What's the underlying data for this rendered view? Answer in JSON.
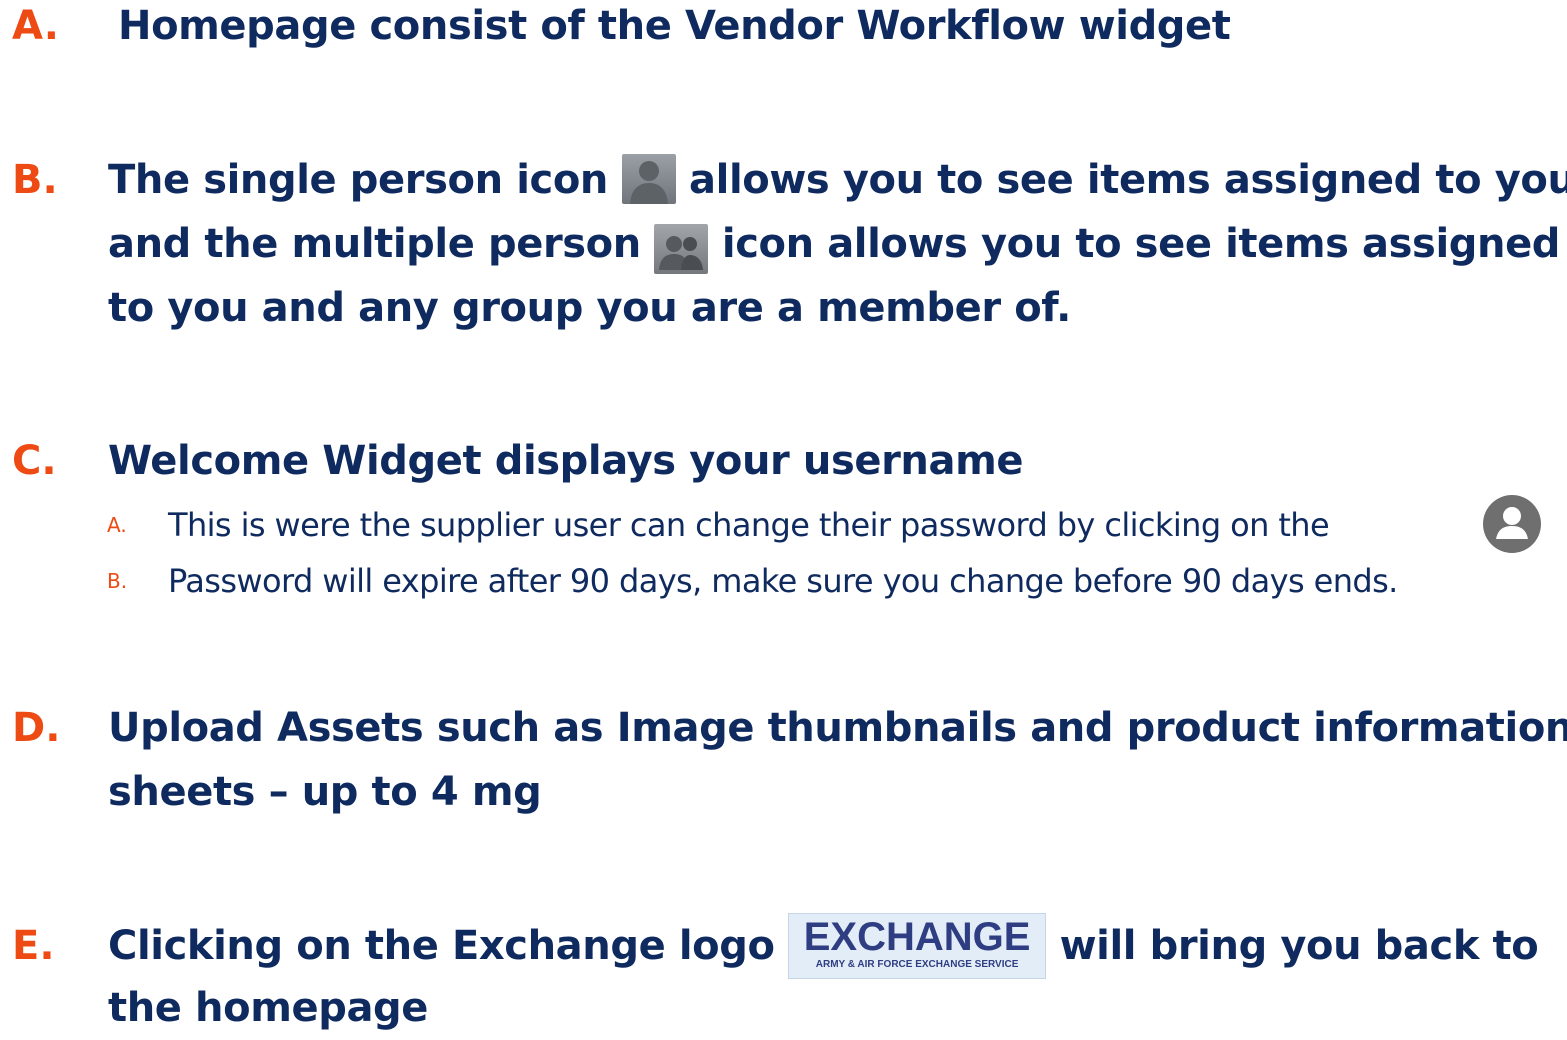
{
  "items": [
    {
      "letter": "A.",
      "text": "Homepage consist of the Vendor Workflow widget"
    },
    {
      "letter": "B.",
      "line1_a": "The single person icon",
      "line1_b": "allows you to see items assigned to you",
      "line2_a": "and the multiple person",
      "line2_b": "icon allows you to see items assigned",
      "line3": "to you and any group you are a member of."
    },
    {
      "letter": "C.",
      "text": "Welcome Widget displays your username",
      "subitems": [
        {
          "letter": "A.",
          "text": "This is were the supplier user can change their password by clicking on the"
        },
        {
          "letter": "B.",
          "text": "Password will expire after 90 days, make sure you change before 90 days ends."
        }
      ]
    },
    {
      "letter": "D.",
      "line1": "Upload Assets such as Image thumbnails and product information",
      "line2": "sheets – up to 4 mg"
    },
    {
      "letter": "E.",
      "line1_a": "Clicking on the Exchange logo",
      "line1_b": "will bring you back to",
      "line2": "the homepage"
    }
  ],
  "logo": {
    "word": "EXCHANGE",
    "tagline": "ARMY & AIR FORCE EXCHANGE SERVICE"
  },
  "icons": {
    "single": "single-person-icon",
    "group": "multiple-person-icon",
    "account": "account-circle-icon"
  },
  "colors": {
    "letter": "#ee4a14",
    "text": "#0e2a5e"
  }
}
